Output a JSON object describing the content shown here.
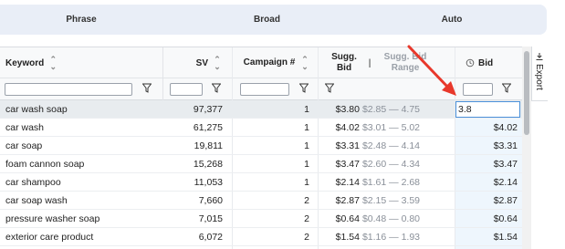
{
  "tabs": [
    {
      "label": "Phrase"
    },
    {
      "label": "Broad"
    },
    {
      "label": "Auto"
    }
  ],
  "columns": {
    "keyword": "Keyword",
    "sv": "SV",
    "campaign": "Campaign #",
    "sugg_bid": "Sugg. Bid",
    "sugg_bid_range": "Sugg. Bid Range",
    "bid": "Bid"
  },
  "export_label": "Export",
  "edit_value": "3.8",
  "rows": [
    {
      "keyword": "car wash soap",
      "sv": "97,377",
      "campaign": "1",
      "sugg_bid": "$3.80",
      "range": "$2.85 — 4.75",
      "bid": ""
    },
    {
      "keyword": "car wash",
      "sv": "61,275",
      "campaign": "1",
      "sugg_bid": "$4.02",
      "range": "$3.01 — 5.02",
      "bid": "$4.02"
    },
    {
      "keyword": "car soap",
      "sv": "19,811",
      "campaign": "1",
      "sugg_bid": "$3.31",
      "range": "$2.48 — 4.14",
      "bid": "$3.31"
    },
    {
      "keyword": "foam cannon soap",
      "sv": "15,268",
      "campaign": "1",
      "sugg_bid": "$3.47",
      "range": "$2.60 — 4.34",
      "bid": "$3.47"
    },
    {
      "keyword": "car shampoo",
      "sv": "11,053",
      "campaign": "1",
      "sugg_bid": "$2.14",
      "range": "$1.61 — 2.68",
      "bid": "$2.14"
    },
    {
      "keyword": "car soap wash",
      "sv": "7,660",
      "campaign": "2",
      "sugg_bid": "$2.87",
      "range": "$2.15 — 3.59",
      "bid": "$2.87"
    },
    {
      "keyword": "pressure washer soap",
      "sv": "7,015",
      "campaign": "2",
      "sugg_bid": "$0.64",
      "range": "$0.48 — 0.80",
      "bid": "$0.64"
    },
    {
      "keyword": "exterior care product",
      "sv": "6,072",
      "campaign": "2",
      "sugg_bid": "$1.54",
      "range": "$1.16 — 1.93",
      "bid": "$1.54"
    }
  ],
  "colors": {
    "accent": "#4a90d9",
    "annotation_arrow": "#e8382b",
    "bid_column_bg": "#eef6fd"
  }
}
